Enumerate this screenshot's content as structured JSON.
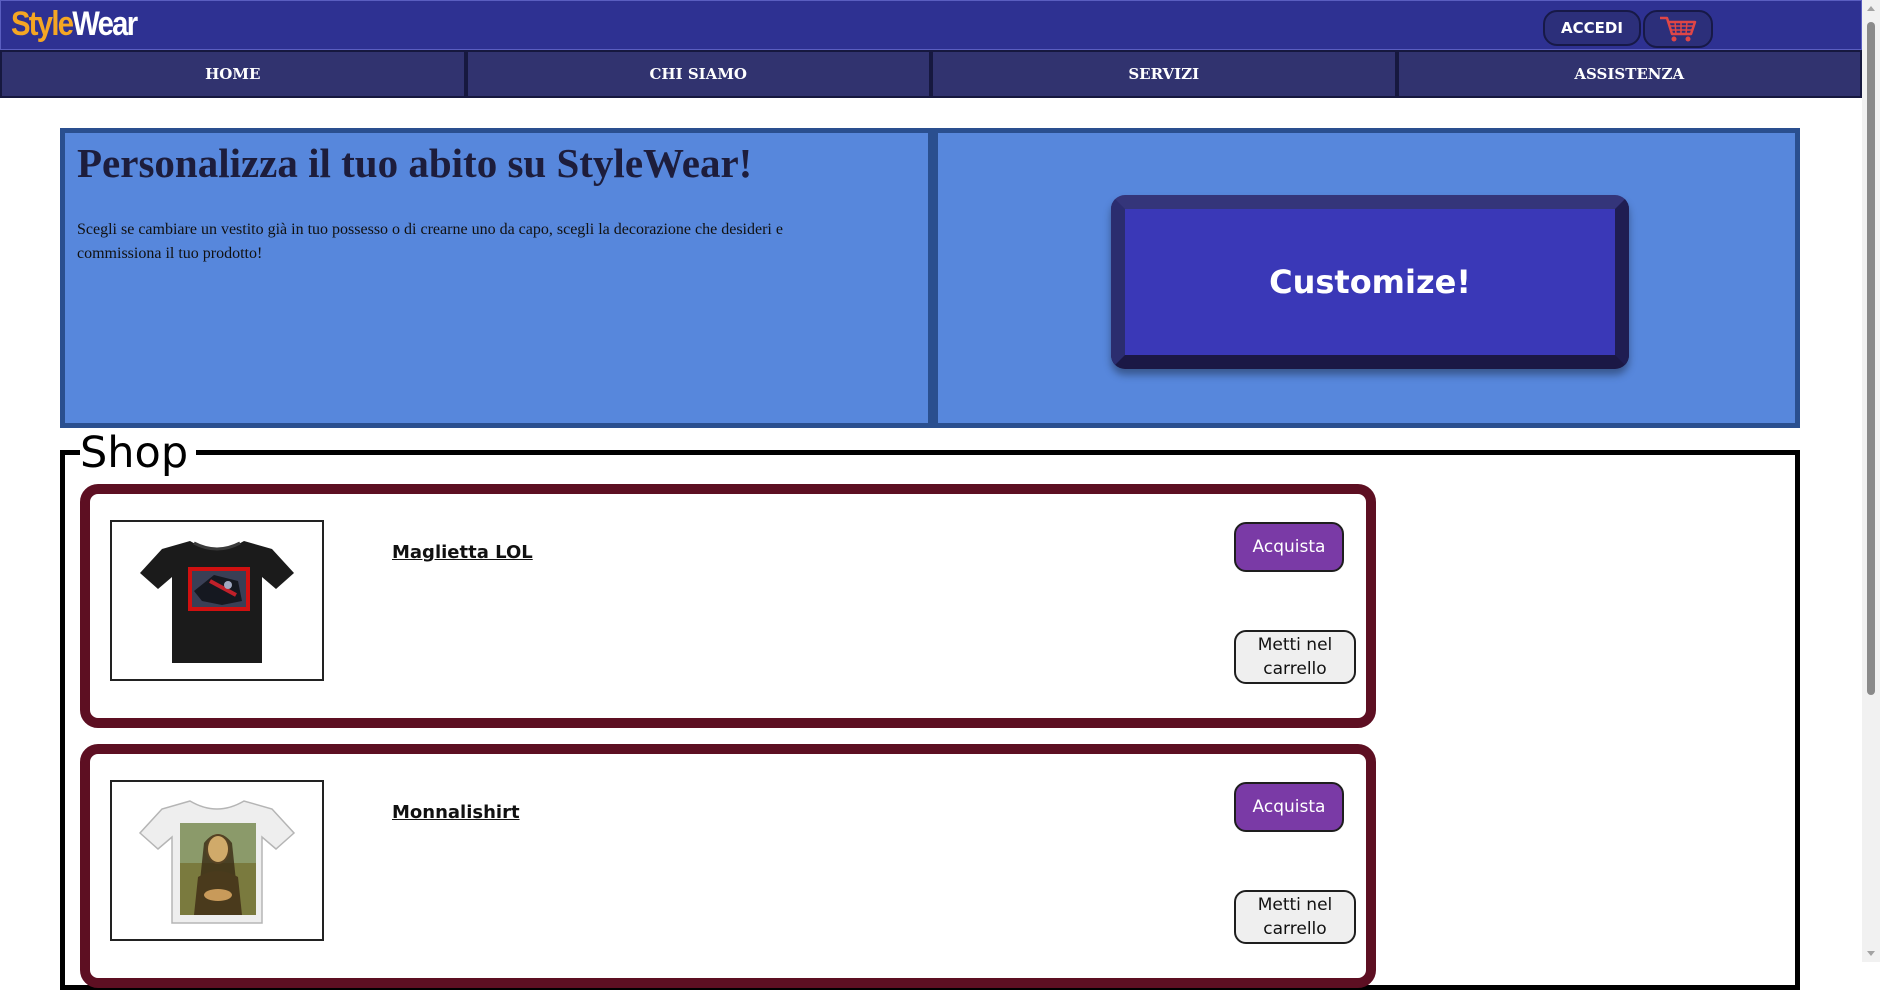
{
  "header": {
    "logo_part1": "Style",
    "logo_part2": "Wear",
    "login_label": "ACCEDI",
    "cart_icon": "shopping-cart-icon",
    "colors": {
      "bar": "#2e3192",
      "logo_accent": "#f5a623",
      "cart_icon": "#e04646"
    }
  },
  "nav": {
    "items": [
      {
        "label": "HOME"
      },
      {
        "label": "CHI SIAMO"
      },
      {
        "label": "SERVIZI"
      },
      {
        "label": "ASSISTENZA"
      }
    ]
  },
  "hero": {
    "title": "Personalizza il tuo abito su StyleWear!",
    "description": "Scegli se cambiare un vestito già in tuo possesso o di crearne uno da capo, scegli la decorazione che desideri e commissiona il tuo prodotto!",
    "cta_label": "Customize!",
    "colors": {
      "background": "#5787dc",
      "button": "#3a38b7"
    }
  },
  "shop": {
    "title": "Shop",
    "products": [
      {
        "name": "Maglietta LOL",
        "image": "black-tshirt-image",
        "buy_label": "Acquista",
        "cart_label": "Metti nel carrello"
      },
      {
        "name": "Monnalishirt",
        "image": "white-tshirt-mona-lisa-image",
        "buy_label": "Acquista",
        "cart_label": "Metti nel carrello"
      }
    ],
    "colors": {
      "card_border": "#5d0f22",
      "buy_button": "#7a3aa6"
    }
  }
}
